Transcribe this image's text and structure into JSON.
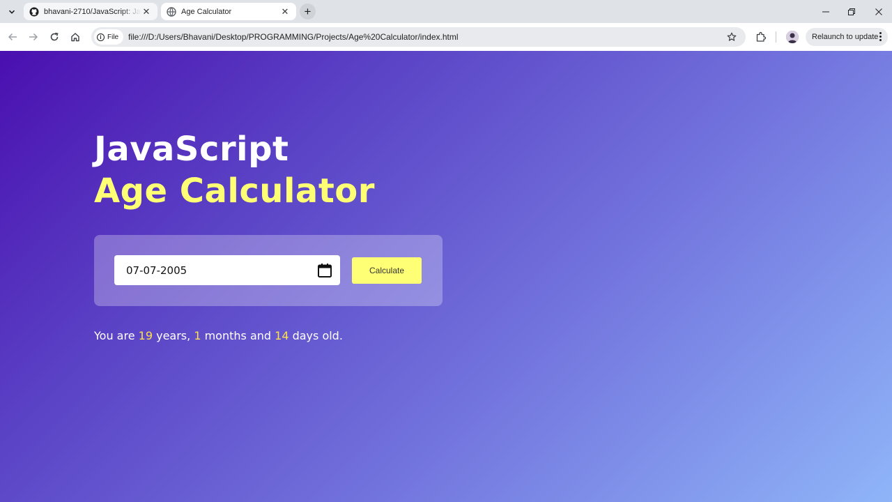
{
  "browser": {
    "tabs": [
      {
        "title": "bhavani-2710/JavaScript: JavaS",
        "icon": "github-icon",
        "active": false
      },
      {
        "title": "Age Calculator",
        "icon": "globe-icon",
        "active": true
      }
    ],
    "address_scheme_label": "File",
    "url": "file:///D:/Users/Bhavani/Desktop/PROGRAMMING/Projects/Age%20Calculator/index.html",
    "relaunch_label": "Relaunch to update"
  },
  "page": {
    "heading_line1": "JavaScript",
    "heading_line2": "Age Calculator",
    "date_value": "07-07-2005",
    "calculate_label": "Calculate",
    "result": {
      "prefix": "You are",
      "years": "19",
      "years_label": "years,",
      "months": "1",
      "months_label": "months and",
      "days": "14",
      "days_label": "days old."
    }
  },
  "colors": {
    "accent_yellow": "#ffff76",
    "gradient_start": "#4a0fb0",
    "gradient_end": "#8fb5f8"
  }
}
